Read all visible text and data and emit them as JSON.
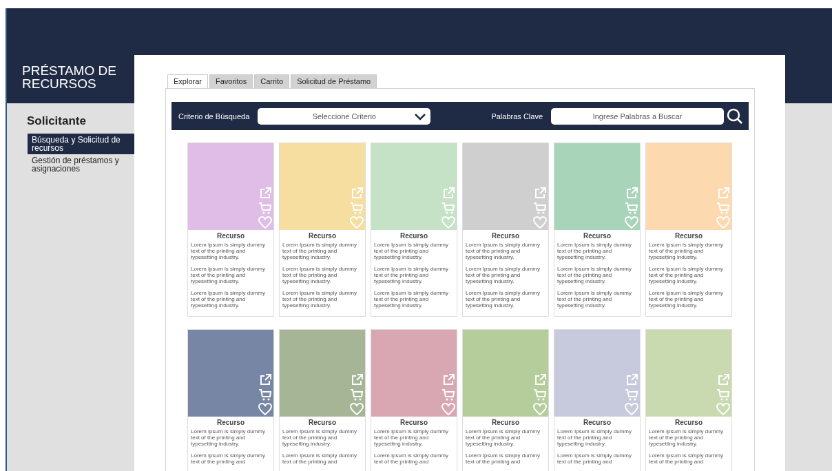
{
  "app": {
    "title": "PRÉSTAMO DE RECURSOS"
  },
  "sidebar": {
    "heading": "Solicitante",
    "items": [
      {
        "label": "Búsqueda y Solicitud de recursos",
        "selected": true
      },
      {
        "label": "Gestión de préstamos y asignaciones",
        "selected": false
      }
    ]
  },
  "tabs": [
    {
      "label": "Explorar",
      "selected": true
    },
    {
      "label": "Favoritos",
      "selected": false
    },
    {
      "label": "Carrito",
      "selected": false
    },
    {
      "label": "Solicitud de Préstamo",
      "selected": false
    }
  ],
  "search": {
    "criteria_label": "Criterio de Búsqueda",
    "criteria_placeholder": "Seleccione Criterio",
    "keywords_label": "Palabras Clave",
    "keywords_placeholder": "Ingrese Palabras a Buscar"
  },
  "cards": [
    {
      "title": "Recurso",
      "color": "#dfbde6",
      "paragraphs": [
        "Lorem Ipsum is simply dummy text of the printing and typesetting industry.",
        "Lorem Ipsum is simply dummy text of the printing and typesetting industry.",
        "Lorem Ipsum is simply dummy text of the printing and typesetting industry."
      ]
    },
    {
      "title": "Recurso",
      "color": "#f6dea0",
      "paragraphs": [
        "Lorem Ipsum is simply dummy text of the printing and typesetting industry.",
        "Lorem Ipsum is simply dummy text of the printing and typesetting industry.",
        "Lorem Ipsum is simply dummy text of the printing and typesetting industry."
      ]
    },
    {
      "title": "Recurso",
      "color": "#c5e2c6",
      "paragraphs": [
        "Lorem Ipsum is simply dummy text of the printing and typesetting industry.",
        "Lorem Ipsum is simply dummy text of the printing and typesetting industry.",
        "Lorem Ipsum is simply dummy text of the printing and typesetting industry."
      ]
    },
    {
      "title": "Recurso",
      "color": "#cfcfcf",
      "paragraphs": [
        "Lorem Ipsum is simply dummy text of the printing and typesetting industry.",
        "Lorem Ipsum is simply dummy text of the printing and typesetting industry.",
        "Lorem Ipsum is simply dummy text of the printing and typesetting industry."
      ]
    },
    {
      "title": "Recurso",
      "color": "#a8d4b9",
      "paragraphs": [
        "Lorem Ipsum is simply dummy text of the printing and typesetting industry.",
        "Lorem Ipsum is simply dummy text of the printing and typesetting industry.",
        "Lorem Ipsum is simply dummy text of the printing and typesetting industry."
      ]
    },
    {
      "title": "Recurso",
      "color": "#fdd9b0",
      "paragraphs": [
        "Lorem Ipsum is simply dummy text of the printing and typesetting industry.",
        "Lorem Ipsum is simply dummy text of the printing and typesetting industry.",
        "Lorem Ipsum is simply dummy text of the printing and typesetting industry."
      ]
    },
    {
      "title": "Recurso",
      "color": "#7686a4",
      "paragraphs": [
        "Lorem Ipsum is simply dummy text of the printing and typesetting industry.",
        "Lorem Ipsum is simply dummy text of the printing and"
      ]
    },
    {
      "title": "Recurso",
      "color": "#a6b596",
      "paragraphs": [
        "Lorem Ipsum is simply dummy text of the printing and typesetting industry.",
        "Lorem Ipsum is simply dummy text of the printing and"
      ]
    },
    {
      "title": "Recurso",
      "color": "#d8a7b1",
      "paragraphs": [
        "Lorem Ipsum is simply dummy text of the printing and typesetting industry.",
        "Lorem Ipsum is simply dummy text of the printing and"
      ]
    },
    {
      "title": "Recurso",
      "color": "#b5cc9b",
      "paragraphs": [
        "Lorem Ipsum is simply dummy text of the printing and typesetting industry.",
        "Lorem Ipsum is simply dummy text of the printing and"
      ]
    },
    {
      "title": "Recurso",
      "color": "#c7cadd",
      "paragraphs": [
        "Lorem Ipsum is simply dummy text of the printing and typesetting industry.",
        "Lorem Ipsum is simply dummy text of the printing and"
      ]
    },
    {
      "title": "Recurso",
      "color": "#c9d9b0",
      "paragraphs": [
        "Lorem Ipsum is simply dummy text of the printing and typesetting industry.",
        "Lorem Ipsum is simply dummy text of the printing and"
      ]
    }
  ]
}
